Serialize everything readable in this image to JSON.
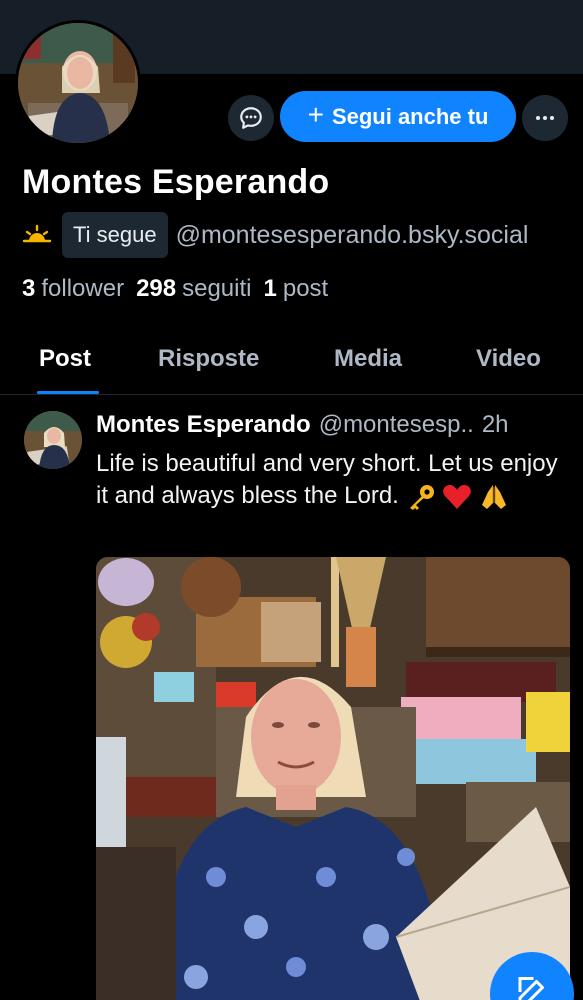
{
  "profile": {
    "display_name": "Montes Esperando",
    "follows_you_label": "Ti segue",
    "handle": "@montesesperando.bsky.social",
    "stats": {
      "followers_count": "3",
      "followers_label": "follower",
      "following_count": "298",
      "following_label": "seguiti",
      "posts_count": "1",
      "posts_label": "post"
    }
  },
  "actions": {
    "follow_label": "Segui anche tu"
  },
  "tabs": [
    {
      "label": "Post",
      "active": true
    },
    {
      "label": "Risposte",
      "active": false
    },
    {
      "label": "Media",
      "active": false
    },
    {
      "label": "Video",
      "active": false
    }
  ],
  "post": {
    "author_name": "Montes Esperando",
    "author_handle_short": "@montesesp..",
    "time": "2h",
    "text": "Life is beautiful and very short. Let us enjoy it and always bless the Lord.",
    "emojis": [
      "key",
      "red-heart",
      "folded-hands"
    ]
  },
  "icons": {
    "message": "chat-bubble-icon",
    "more": "ellipsis-icon",
    "compose": "edit-icon",
    "status": "sunrise-icon"
  },
  "colors": {
    "accent": "#1083fe",
    "background": "#000000",
    "banner": "#161e27",
    "muted_text": "#aeb9c5",
    "surface": "#1e2833"
  }
}
